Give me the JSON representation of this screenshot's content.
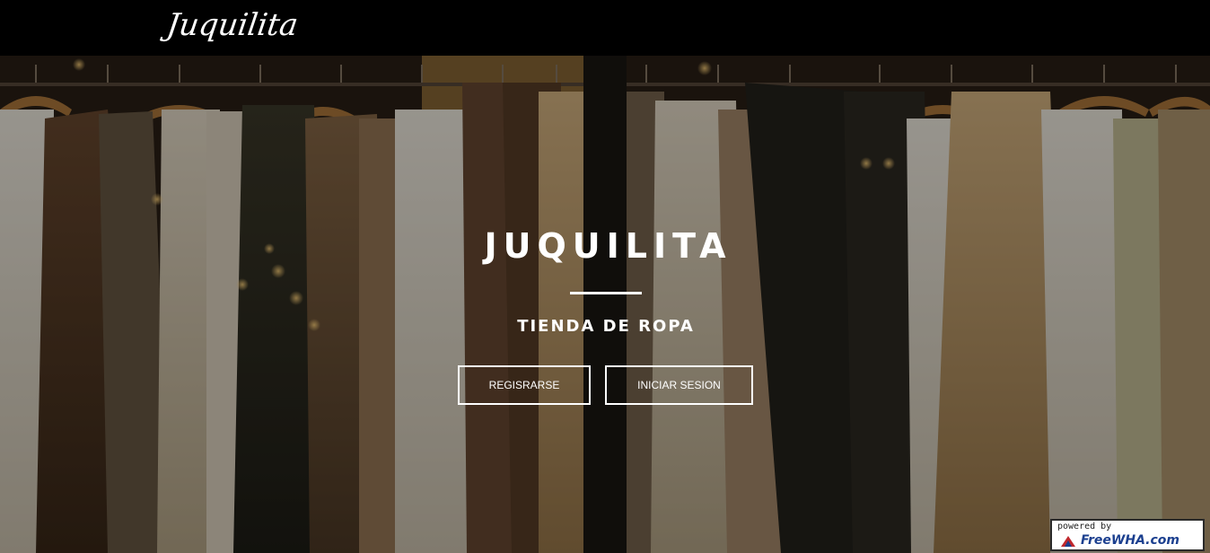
{
  "navbar": {
    "logo_text": "Juquilita"
  },
  "hero": {
    "title": "JUQUILITA",
    "subtitle": "TIENDA DE ROPA",
    "buttons": {
      "register_label": "REGISRARSE",
      "login_label": "INICIAR SESION"
    }
  },
  "badge": {
    "powered_text": "powered by",
    "brand_text": "FreeWHA.com"
  },
  "colors": {
    "navbar_bg": "#000000",
    "hero_text": "#ffffff",
    "badge_brand": "#1b3f8f",
    "badge_mark": "#c0282d"
  }
}
